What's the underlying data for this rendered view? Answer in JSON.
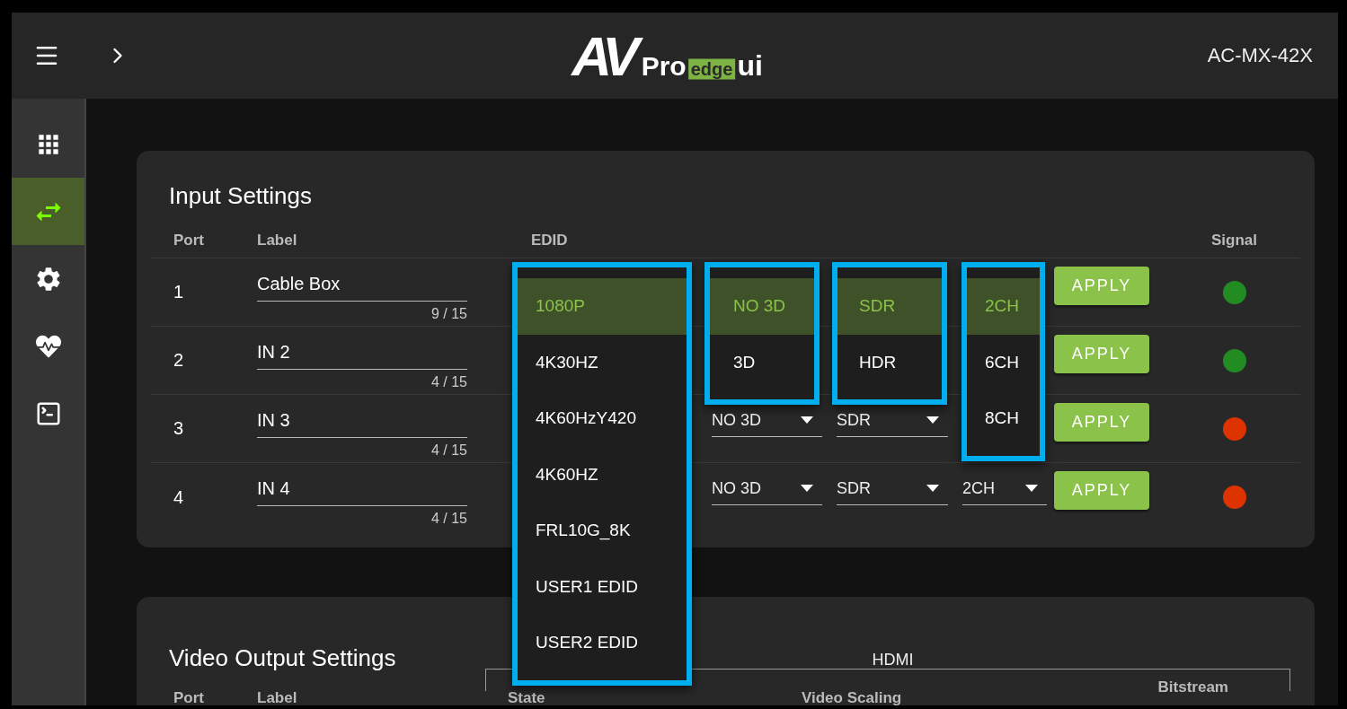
{
  "header": {
    "logo": {
      "mark": "AV",
      "pro": "Pro",
      "edge": "edge",
      "ui": "ui"
    },
    "model": "AC-MX-42X"
  },
  "sidebar": {
    "items": [
      {
        "kind": "grid",
        "selected": false
      },
      {
        "kind": "routing",
        "selected": true
      },
      {
        "kind": "settings",
        "selected": false
      },
      {
        "kind": "health",
        "selected": false
      },
      {
        "kind": "terminal",
        "selected": false
      }
    ]
  },
  "input_settings": {
    "title": "Input Settings",
    "columns": {
      "port": "Port",
      "label": "Label",
      "edid": "EDID",
      "signal": "Signal"
    },
    "rows": [
      {
        "port": "1",
        "label": "Cable Box",
        "counter": "9 / 15",
        "button": "APPLY",
        "color": "#228b22"
      },
      {
        "port": "2",
        "label": "IN 2",
        "counter": "4 / 15",
        "button": "APPLY",
        "color": "#228b22"
      },
      {
        "port": "3",
        "label": "IN 3",
        "counter": "4 / 15",
        "three_d": "NO 3D",
        "hdr": "SDR",
        "button": "APPLY",
        "color": "#dd3300"
      },
      {
        "port": "4",
        "label": "IN 4",
        "counter": "4 / 15",
        "three_d": "NO 3D",
        "hdr": "SDR",
        "audio": "2CH",
        "button": "APPLY",
        "color": "#dd3300"
      }
    ],
    "open_menus": [
      {
        "kind": "edid",
        "items": [
          {
            "label": "1080P",
            "selected": true
          },
          {
            "label": "4K30HZ",
            "selected": false
          },
          {
            "label": "4K60HzY420",
            "selected": false
          },
          {
            "label": "4K60HZ",
            "selected": false
          },
          {
            "label": "FRL10G_8K",
            "selected": false
          },
          {
            "label": "USER1 EDID",
            "selected": false
          },
          {
            "label": "USER2 EDID",
            "selected": false
          }
        ]
      },
      {
        "kind": "three_d",
        "items": [
          {
            "label": "NO 3D",
            "selected": true
          },
          {
            "label": "3D",
            "selected": false
          }
        ]
      },
      {
        "kind": "hdr",
        "items": [
          {
            "label": "SDR",
            "selected": true
          },
          {
            "label": "HDR",
            "selected": false
          }
        ]
      },
      {
        "kind": "audio",
        "items": [
          {
            "label": "2CH",
            "selected": true
          },
          {
            "label": "6CH",
            "selected": false
          },
          {
            "label": "8CH",
            "selected": false
          }
        ]
      }
    ]
  },
  "video_output_settings": {
    "title": "Video Output Settings",
    "group_heading": "HDMI",
    "columns": {
      "port": "Port",
      "label": "Label",
      "state": "State",
      "video_scaling": "Video Scaling",
      "bitstream": "Bitstream"
    }
  }
}
